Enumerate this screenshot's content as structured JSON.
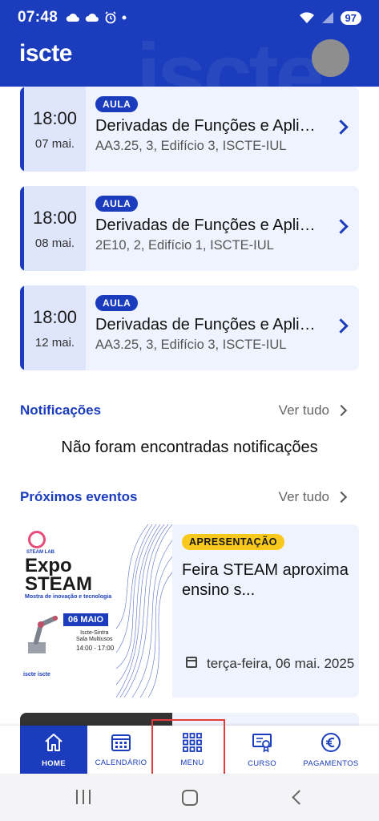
{
  "status_bar": {
    "time": "07:48",
    "battery": "97"
  },
  "header": {
    "logo": "iscte"
  },
  "classes": [
    {
      "time": "18:00",
      "date": "07 mai.",
      "badge": "AULA",
      "title": "Derivadas de Funções e Aplicações",
      "location": "AA3.25, 3, Edifício 3, ISCTE-IUL"
    },
    {
      "time": "18:00",
      "date": "08 mai.",
      "badge": "AULA",
      "title": "Derivadas de Funções e Aplicações",
      "location": "2E10, 2, Edifício 1, ISCTE-IUL"
    },
    {
      "time": "18:00",
      "date": "12 mai.",
      "badge": "AULA",
      "title": "Derivadas de Funções e Aplicações",
      "location": "AA3.25, 3, Edifício 3, ISCTE-IUL"
    }
  ],
  "notifications": {
    "title": "Notificações",
    "see_all": "Ver tudo",
    "empty": "Não foram encontradas notificações"
  },
  "events": {
    "title": "Próximos eventos",
    "see_all": "Ver tudo",
    "items": [
      {
        "badge": "APRESENTAÇÃO",
        "title": "Feira STEAM aproxima ensino s...",
        "date": "terça-feira, 06 mai. 2025",
        "poster": {
          "logo_text": "STEAM LAB",
          "title_line1": "Expo",
          "title_line2": "STEAM",
          "subtitle": "Mostra de inovação e tecnologia",
          "date": "06 MAIO",
          "place_line1": "Iscte-Sintra",
          "place_line2": "Sala Multiusos",
          "hours": "14:00 - 17:00",
          "footer": "iscte  iscte"
        }
      }
    ]
  },
  "bottom_nav": [
    {
      "label": "HOME",
      "icon": "home-icon"
    },
    {
      "label": "CALENDÁRIO",
      "icon": "calendar-icon"
    },
    {
      "label": "MENU",
      "icon": "grid-icon"
    },
    {
      "label": "CURSO",
      "icon": "certificate-icon"
    },
    {
      "label": "PAGAMENTOS",
      "icon": "euro-icon"
    }
  ],
  "colors": {
    "primary": "#1b3dbd",
    "accent": "#f8c81c",
    "card_bg": "#eef3fd",
    "highlight": "#e53b3b"
  }
}
